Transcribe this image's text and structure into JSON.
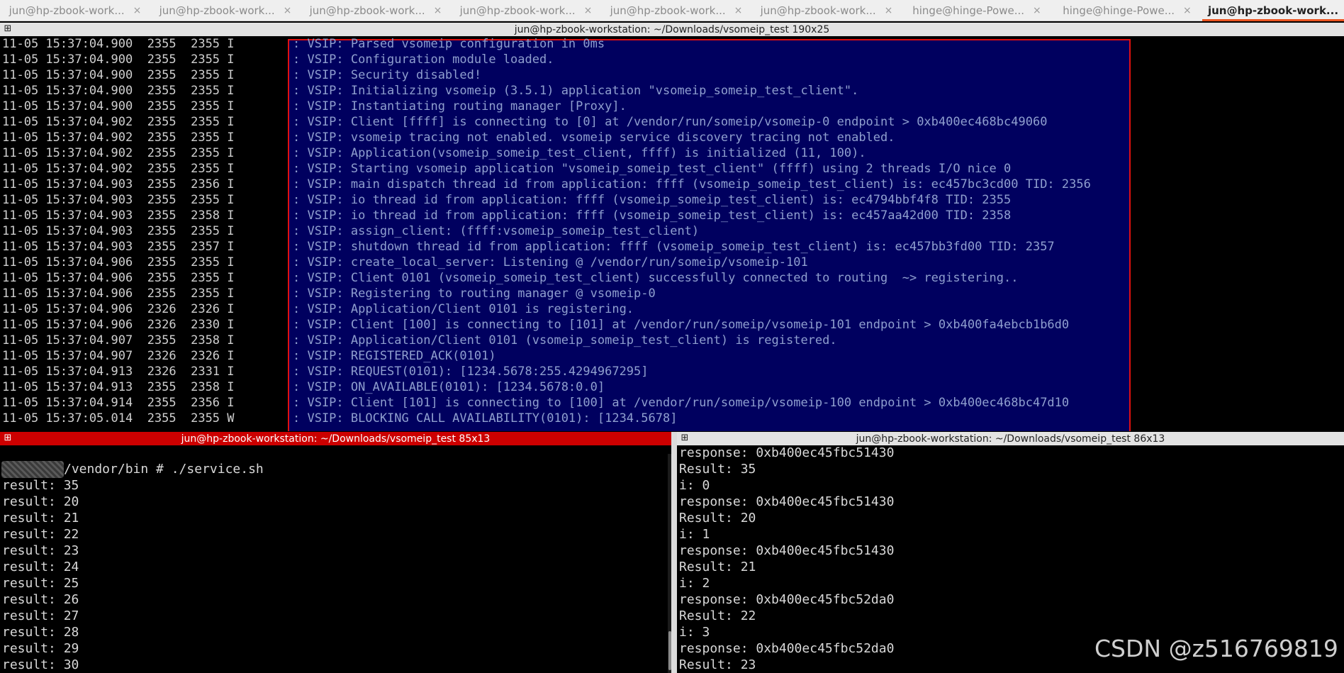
{
  "tabs": [
    {
      "label": "jun@hp-zbook-work...",
      "close": "×"
    },
    {
      "label": "jun@hp-zbook-work...",
      "close": "×"
    },
    {
      "label": "jun@hp-zbook-work...",
      "close": "×"
    },
    {
      "label": "jun@hp-zbook-work...",
      "close": "×"
    },
    {
      "label": "jun@hp-zbook-work...",
      "close": "×"
    },
    {
      "label": "jun@hp-zbook-work...",
      "close": "×"
    },
    {
      "label": "hinge@hinge-Powe...",
      "close": "×"
    },
    {
      "label": "hinge@hinge-Powe...",
      "close": "×"
    },
    {
      "label": "jun@hp-zbook-work...",
      "close": "×"
    }
  ],
  "active_tab_index": 8,
  "top_pane": {
    "title": "jun@hp-zbook-workstation: ~/Downloads/vsomeip_test 190x25",
    "lines": [
      {
        "meta": "11-05 15:37:04.900  2355  2355 I",
        "msg": ": VSIP: Parsed vsomeip configuration in 0ms"
      },
      {
        "meta": "11-05 15:37:04.900  2355  2355 I",
        "msg": ": VSIP: Configuration module loaded."
      },
      {
        "meta": "11-05 15:37:04.900  2355  2355 I",
        "msg": ": VSIP: Security disabled!"
      },
      {
        "meta": "11-05 15:37:04.900  2355  2355 I",
        "msg": ": VSIP: Initializing vsomeip (3.5.1) application \"vsomeip_someip_test_client\"."
      },
      {
        "meta": "11-05 15:37:04.900  2355  2355 I",
        "msg": ": VSIP: Instantiating routing manager [Proxy]."
      },
      {
        "meta": "11-05 15:37:04.902  2355  2355 I",
        "msg": ": VSIP: Client [ffff] is connecting to [0] at /vendor/run/someip/vsomeip-0 endpoint > 0xb400ec468bc49060"
      },
      {
        "meta": "11-05 15:37:04.902  2355  2355 I",
        "msg": ": VSIP: vsomeip tracing not enabled. vsomeip service discovery tracing not enabled."
      },
      {
        "meta": "11-05 15:37:04.902  2355  2355 I",
        "msg": ": VSIP: Application(vsomeip_someip_test_client, ffff) is initialized (11, 100)."
      },
      {
        "meta": "11-05 15:37:04.902  2355  2355 I",
        "msg": ": VSIP: Starting vsomeip application \"vsomeip_someip_test_client\" (ffff) using 2 threads I/O nice 0"
      },
      {
        "meta": "11-05 15:37:04.903  2355  2356 I",
        "msg": ": VSIP: main dispatch thread id from application: ffff (vsomeip_someip_test_client) is: ec457bc3cd00 TID: 2356"
      },
      {
        "meta": "11-05 15:37:04.903  2355  2355 I",
        "msg": ": VSIP: io thread id from application: ffff (vsomeip_someip_test_client) is: ec4794bbf4f8 TID: 2355"
      },
      {
        "meta": "11-05 15:37:04.903  2355  2358 I",
        "msg": ": VSIP: io thread id from application: ffff (vsomeip_someip_test_client) is: ec457aa42d00 TID: 2358"
      },
      {
        "meta": "11-05 15:37:04.903  2355  2355 I",
        "msg": ": VSIP: assign_client: (ffff:vsomeip_someip_test_client)"
      },
      {
        "meta": "11-05 15:37:04.903  2355  2357 I",
        "msg": ": VSIP: shutdown thread id from application: ffff (vsomeip_someip_test_client) is: ec457bb3fd00 TID: 2357"
      },
      {
        "meta": "11-05 15:37:04.906  2355  2355 I",
        "msg": ": VSIP: create_local_server: Listening @ /vendor/run/someip/vsomeip-101"
      },
      {
        "meta": "11-05 15:37:04.906  2355  2355 I",
        "msg": ": VSIP: Client 0101 (vsomeip_someip_test_client) successfully connected to routing  ~> registering.."
      },
      {
        "meta": "11-05 15:37:04.906  2355  2355 I",
        "msg": ": VSIP: Registering to routing manager @ vsomeip-0"
      },
      {
        "meta": "11-05 15:37:04.906  2326  2326 I",
        "msg": ": VSIP: Application/Client 0101 is registering."
      },
      {
        "meta": "11-05 15:37:04.906  2326  2330 I",
        "msg": ": VSIP: Client [100] is connecting to [101] at /vendor/run/someip/vsomeip-101 endpoint > 0xb400fa4ebcb1b6d0"
      },
      {
        "meta": "11-05 15:37:04.907  2355  2358 I",
        "msg": ": VSIP: Application/Client 0101 (vsomeip_someip_test_client) is registered."
      },
      {
        "meta": "11-05 15:37:04.907  2326  2326 I",
        "msg": ": VSIP: REGISTERED_ACK(0101)"
      },
      {
        "meta": "11-05 15:37:04.913  2326  2331 I",
        "msg": ": VSIP: REQUEST(0101): [1234.5678:255.4294967295]"
      },
      {
        "meta": "11-05 15:37:04.913  2355  2358 I",
        "msg": ": VSIP: ON_AVAILABLE(0101): [1234.5678:0.0]"
      },
      {
        "meta": "11-05 15:37:04.914  2355  2356 I",
        "msg": ": VSIP: Client [101] is connecting to [100] at /vendor/run/someip/vsomeip-100 endpoint > 0xb400ec468bc47d10"
      },
      {
        "meta": "11-05 15:37:05.014  2355  2355 W",
        "msg": ": VSIP: BLOCKING CALL AVAILABILITY(0101): [1234.5678]"
      }
    ]
  },
  "bottom_left": {
    "title": "jun@hp-zbook-workstation: ~/Downloads/vsomeip_test 85x13",
    "prompt": "/vendor/bin # ./service.sh",
    "lines": [
      "result: 35",
      "result: 20",
      "result: 21",
      "result: 22",
      "result: 23",
      "result: 24",
      "result: 25",
      "result: 26",
      "result: 27",
      "result: 28",
      "result: 29",
      "result: 30"
    ]
  },
  "bottom_right": {
    "title": "jun@hp-zbook-workstation: ~/Downloads/vsomeip_test 86x13",
    "lines": [
      "response: 0xb400ec45fbc51430",
      "Result: 35",
      "i: 0",
      "response: 0xb400ec45fbc51430",
      "Result: 20",
      "i: 1",
      "response: 0xb400ec45fbc51430",
      "Result: 21",
      "i: 2",
      "response: 0xb400ec45fbc52da0",
      "Result: 22",
      "i: 3",
      "response: 0xb400ec45fbc52da0",
      "Result: 23"
    ]
  },
  "watermark": "CSDN @z516769819",
  "colors": {
    "tab_accent": "#e95420",
    "highlight_box_bg": "#00005f",
    "highlight_box_border": "#e01010",
    "active_pane_title": "#cc0000"
  }
}
